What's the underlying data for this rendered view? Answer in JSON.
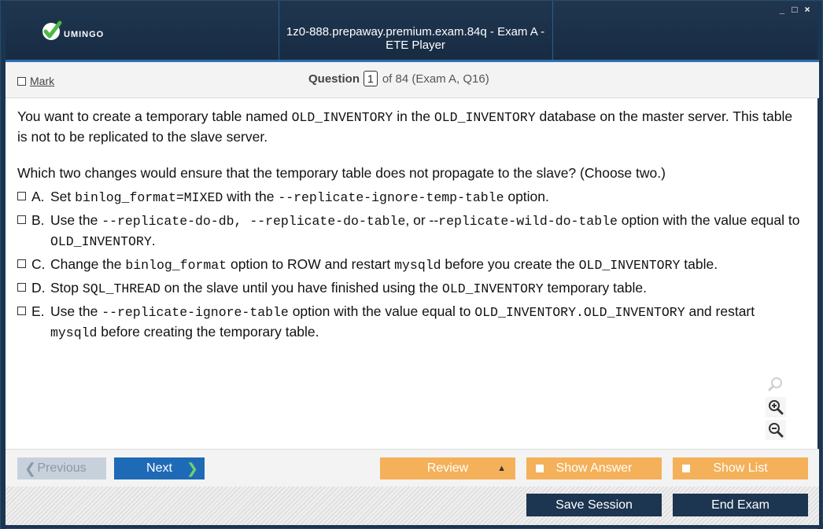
{
  "window": {
    "title": "1z0-888.prepaway.premium.exam.84q - Exam A - ETE Player",
    "logo_text": "UMINGO",
    "controls": [
      "_",
      "□",
      "×"
    ]
  },
  "header": {
    "mark_label": "Mark",
    "question_label": "Question",
    "question_number": "1",
    "question_of": "of 84 (Exam A, Q16)"
  },
  "question": {
    "p1": [
      {
        "t": "You want to create a temporary table named "
      },
      {
        "m": "OLD_INVENTORY"
      },
      {
        "t": " in the "
      },
      {
        "m": "OLD_INVENTORY"
      },
      {
        "t": " database on the master server. This table is not to be replicated to the slave server."
      }
    ],
    "p2": "Which two changes would ensure that the temporary table does not propagate to the slave? (Choose two.)",
    "options": [
      {
        "label": "A.",
        "parts": [
          {
            "t": "Set "
          },
          {
            "m": "binlog_format=MIXED"
          },
          {
            "t": "  with the "
          },
          {
            "m": "--replicate-ignore-temp-table"
          },
          {
            "t": "  option."
          }
        ]
      },
      {
        "label": "B.",
        "parts": [
          {
            "t": "Use the "
          },
          {
            "m": "--replicate-do-db, --replicate-do-table"
          },
          {
            "t": ", or --"
          },
          {
            "m": "replicate-wild-do-table"
          },
          {
            "t": " option with the value equal to "
          },
          {
            "m": "OLD_INVENTORY"
          },
          {
            "t": "."
          }
        ]
      },
      {
        "label": "C.",
        "parts": [
          {
            "t": "Change the "
          },
          {
            "m": "binlog_format"
          },
          {
            "t": " option to ROW and restart "
          },
          {
            "m": "mysqld"
          },
          {
            "t": "  before you create the "
          },
          {
            "m": "OLD_INVENTORY"
          },
          {
            "t": " table."
          }
        ]
      },
      {
        "label": "D.",
        "parts": [
          {
            "t": "Stop "
          },
          {
            "m": "SQL_THREAD"
          },
          {
            "t": " on the slave until you have finished using the "
          },
          {
            "m": "OLD_INVENTORY"
          },
          {
            "t": " temporary table."
          }
        ]
      },
      {
        "label": "E.",
        "parts": [
          {
            "t": "Use the "
          },
          {
            "m": "--replicate-ignore-table"
          },
          {
            "t": " option with the value equal to "
          },
          {
            "m": "OLD_INVENTORY.OLD_INVENTORY"
          },
          {
            "t": " and restart "
          },
          {
            "m": "mysqld"
          },
          {
            "t": " before creating the temporary table."
          }
        ]
      }
    ]
  },
  "nav": {
    "previous": "Previous",
    "next": "Next",
    "review": "Review",
    "show_answer": "Show Answer",
    "show_list": "Show List"
  },
  "footer": {
    "save_session": "Save Session",
    "end_exam": "End Exam"
  },
  "colors": {
    "titlebar": "#1d3450",
    "accent_blue": "#1f6ab6",
    "orange": "#f5b05a",
    "dark_button": "#1c3550"
  }
}
